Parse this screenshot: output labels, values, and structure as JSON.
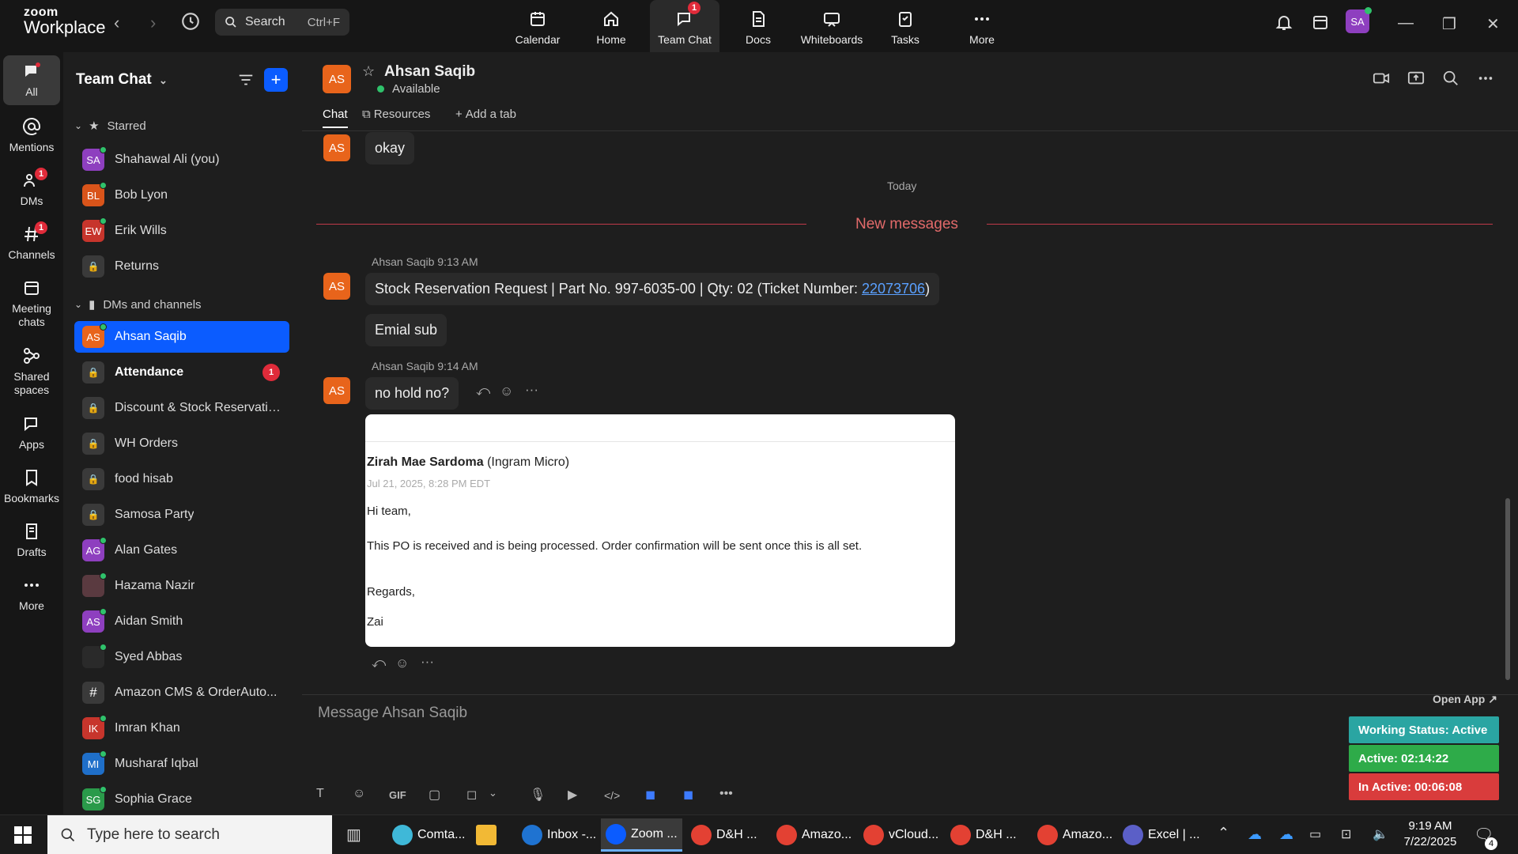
{
  "app": {
    "brand_top": "zoom",
    "brand_bottom": "Workplace"
  },
  "search": {
    "label": "Search",
    "shortcut": "Ctrl+F"
  },
  "topnav": [
    {
      "label": "Calendar",
      "icon": "calendar-icon"
    },
    {
      "label": "Home",
      "icon": "home-icon"
    },
    {
      "label": "Team Chat",
      "icon": "chat-icon",
      "badge": "1",
      "active": true
    },
    {
      "label": "Docs",
      "icon": "docs-icon"
    },
    {
      "label": "Whiteboards",
      "icon": "whiteboard-icon"
    },
    {
      "label": "Tasks",
      "icon": "tasks-icon"
    },
    {
      "label": "More",
      "icon": "more-icon"
    }
  ],
  "user": {
    "initials": "SA"
  },
  "rail": [
    {
      "label": "All",
      "active": true
    },
    {
      "label": "Mentions"
    },
    {
      "label": "DMs",
      "badge": "1"
    },
    {
      "label": "Channels",
      "badge": "1"
    },
    {
      "label": "Meeting chats"
    },
    {
      "label": "Shared spaces"
    },
    {
      "label": "Apps"
    },
    {
      "label": "Bookmarks"
    },
    {
      "label": "Drafts"
    },
    {
      "label": "More"
    }
  ],
  "sidebar": {
    "title": "Team Chat",
    "starred_label": "Starred",
    "starred": [
      {
        "name": "Shahawal Ali (you)",
        "initials": "SA",
        "color": "#8e3fbf",
        "online": true
      },
      {
        "name": "Bob Lyon",
        "initials": "BL",
        "color": "#d9541a",
        "online": true
      },
      {
        "name": "Erik Wills",
        "initials": "EW",
        "color": "#c7352c",
        "online": true
      },
      {
        "name": "Returns",
        "lock": true
      }
    ],
    "dms_label": "DMs and channels",
    "dms": [
      {
        "name": "Ahsan Saqib",
        "initials": "AS",
        "color": "#e8641b",
        "online": true,
        "selected": true
      },
      {
        "name": "Attendance",
        "lock": true,
        "bold": true,
        "badge": "1"
      },
      {
        "name": "Discount & Stock Reservatio...",
        "lock": true
      },
      {
        "name": "WH Orders",
        "lock": true
      },
      {
        "name": "food hisab",
        "lock": true
      },
      {
        "name": "Samosa Party",
        "lock": true
      },
      {
        "name": "Alan Gates",
        "initials": "AG",
        "color": "#8e3fbf",
        "online": true
      },
      {
        "name": "Hazama Nazir",
        "initials": "",
        "color": "#5a3a40",
        "online": true
      },
      {
        "name": "Aidan Smith",
        "initials": "AS",
        "color": "#8e3fbf",
        "online": true
      },
      {
        "name": "Syed Abbas",
        "initials": "",
        "color": "#2a2a2a",
        "online": true
      },
      {
        "name": "Amazon CMS & OrderAuto...",
        "hash": true
      },
      {
        "name": "Imran Khan",
        "initials": "IK",
        "color": "#c7352c",
        "online": true
      },
      {
        "name": "Musharaf Iqbal",
        "initials": "MI",
        "color": "#1f6fc9",
        "online": true
      },
      {
        "name": "Sophia Grace",
        "initials": "SG",
        "color": "#2a9a4a",
        "online": true
      }
    ]
  },
  "header": {
    "initials": "AS",
    "name": "Ahsan Saqib",
    "status": "Available",
    "tabs": [
      "Chat",
      "Resources",
      "Add a tab"
    ]
  },
  "messages": {
    "prev_text": "okay",
    "prev_initials": "AS",
    "date_divider": "Today",
    "new_messages": "New messages",
    "m1_meta": "Ahsan Saqib 9:13 AM",
    "m1_initials": "AS",
    "m1_text": "Stock Reservation Request | Part No. 997-6035-00 | Qty: 02 (Ticket Number: ",
    "m1_link": "22073706",
    "m1_tail": ")",
    "m1b_text": "Emial sub",
    "m2_meta": "Ahsan Saqib 9:14 AM",
    "m2_initials": "AS",
    "m2_text": "no hold no?"
  },
  "email": {
    "sender": "Zirah Mae Sardoma",
    "org": "(Ingram Micro)",
    "date": "Jul 21, 2025, 8:28 PM EDT",
    "greeting": "Hi team,",
    "body": "This PO is received and is being processed. Order confirmation will be sent once this is all set.",
    "signoff": "Regards,",
    "sig": "Zai"
  },
  "composer": {
    "placeholder": "Message Ahsan Saqib",
    "tools": [
      "T",
      "☺",
      "GIF",
      "▢",
      "◻",
      "⌄",
      "🎙",
      "▶",
      "</>",
      "◼",
      "◼",
      "•••"
    ]
  },
  "widget": {
    "open_app": "Open App ↗",
    "working": "Working Status: Active",
    "active": "Active: 02:14:22",
    "inactive": "In Active: 00:06:08",
    "colors": {
      "working": "#2aa5a2",
      "active": "#2eab49",
      "inactive": "#d93c3c"
    }
  },
  "taskbar": {
    "search_placeholder": "Type here to search",
    "apps": [
      {
        "label": "Comta...",
        "color": "#3fb8d8"
      },
      {
        "label": "",
        "color": "#f2b935",
        "folder": true
      },
      {
        "label": "Inbox -...",
        "color": "#1f73d1"
      },
      {
        "label": "Zoom ...",
        "color": "#0b5cff",
        "active": true
      },
      {
        "label": "D&H ...",
        "color": "#e34133"
      },
      {
        "label": "Amazo...",
        "color": "#e34133"
      },
      {
        "label": "vCloud...",
        "color": "#e34133"
      },
      {
        "label": "D&H ...",
        "color": "#e34133"
      },
      {
        "label": "Amazo...",
        "color": "#e34133"
      },
      {
        "label": "Excel | ...",
        "color": "#5b5fc7"
      }
    ],
    "time": "9:19 AM",
    "date": "7/22/2025",
    "notif": "4"
  }
}
